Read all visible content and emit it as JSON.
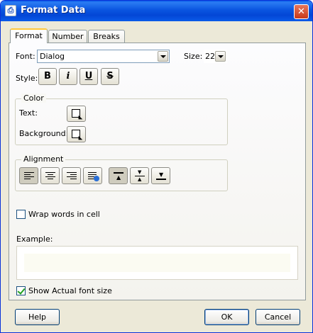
{
  "window": {
    "title": "Format Data"
  },
  "tabs": [
    {
      "label": "Format",
      "active": true
    },
    {
      "label": "Number",
      "active": false
    },
    {
      "label": "Breaks",
      "active": false
    }
  ],
  "font": {
    "label": "Font:",
    "value": "Dialog"
  },
  "size": {
    "label": "Size:",
    "value": "22"
  },
  "style": {
    "label": "Style:",
    "buttons": [
      "B",
      "i",
      "U",
      "S"
    ]
  },
  "color_group": {
    "title": "Color",
    "text_label": "Text:",
    "background_label": "Background:"
  },
  "alignment_group": {
    "title": "Alignment"
  },
  "wrap": {
    "label": "Wrap words in cell",
    "checked": false
  },
  "example": {
    "label": "Example:"
  },
  "show_actual": {
    "label": "Show Actual font size",
    "checked": true
  },
  "footer": {
    "help": "Help",
    "ok": "OK",
    "cancel": "Cancel"
  },
  "colors": {
    "title_bar": "#0a55e0",
    "dialog_bg": "#ece9d8",
    "check_green": "#21a121"
  }
}
